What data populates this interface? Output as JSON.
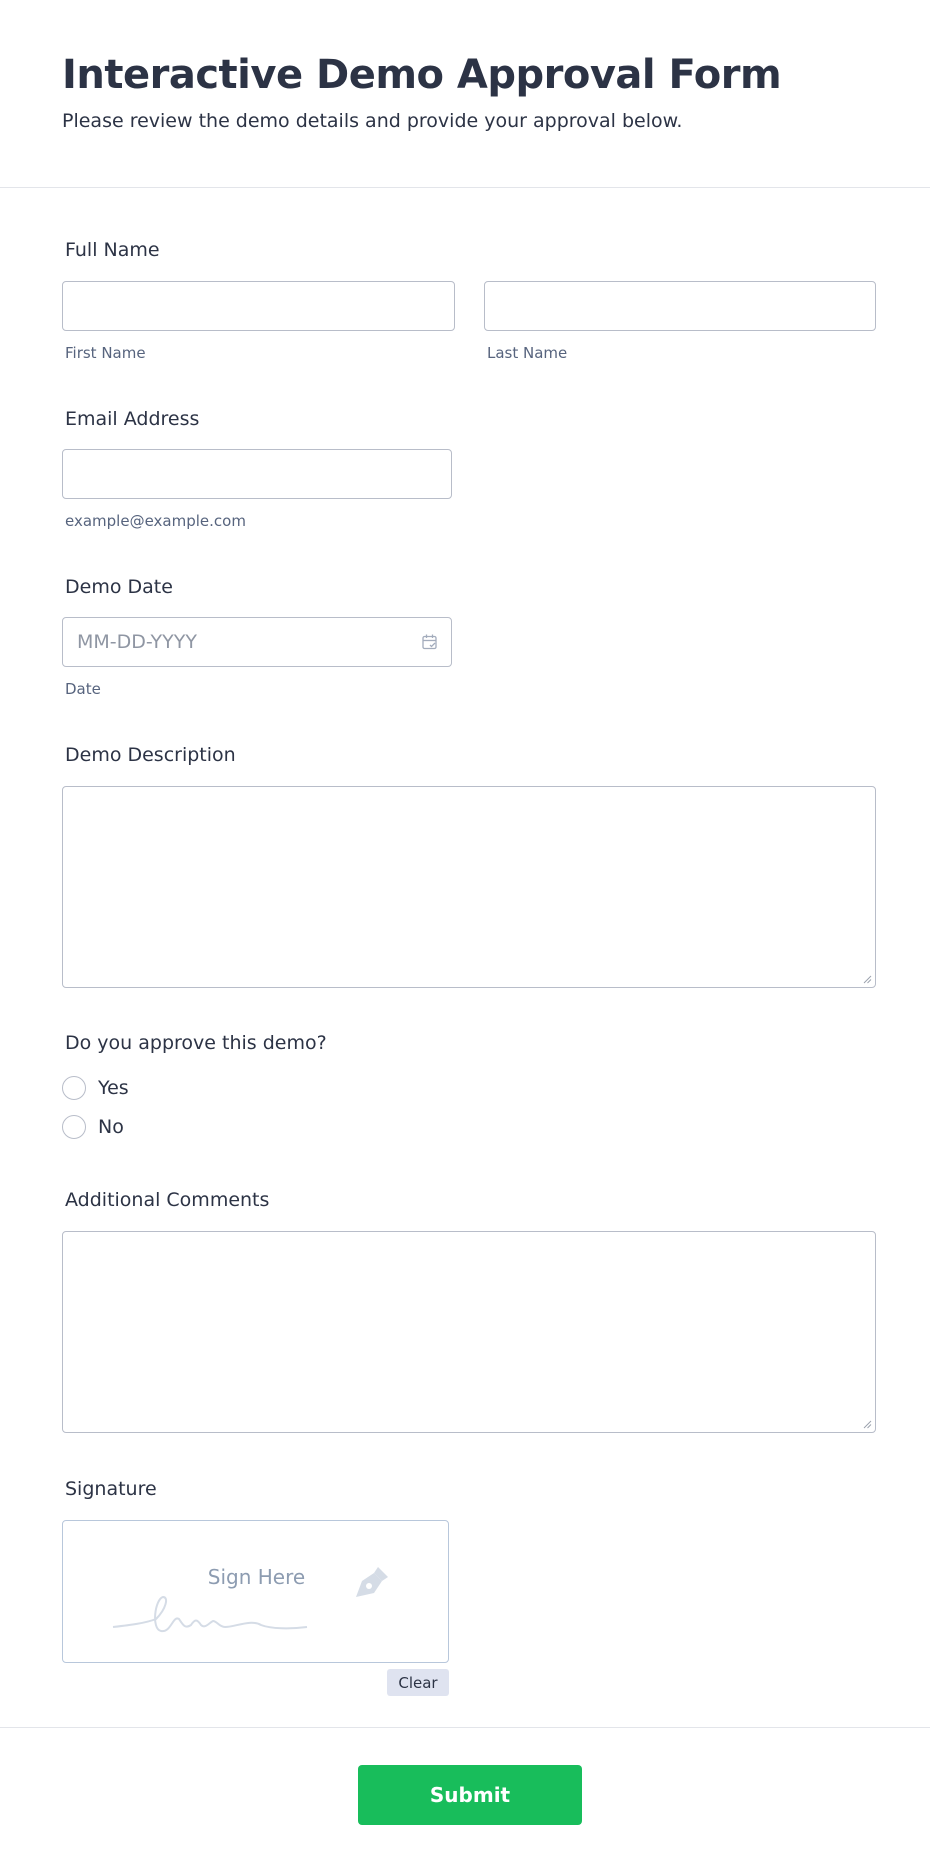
{
  "header": {
    "title": "Interactive Demo Approval Form",
    "subtitle": "Please review the demo details and provide your approval below."
  },
  "full_name": {
    "label": "Full Name",
    "first_sublabel": "First Name",
    "last_sublabel": "Last Name",
    "first_value": "",
    "last_value": ""
  },
  "email": {
    "label": "Email Address",
    "sublabel": "example@example.com",
    "value": ""
  },
  "demo_date": {
    "label": "Demo Date",
    "placeholder": "MM-DD-YYYY",
    "sublabel": "Date",
    "icon": "calendar-icon"
  },
  "demo_description": {
    "label": "Demo Description"
  },
  "approval": {
    "label": "Do you approve this demo?",
    "options": [
      "Yes",
      "No"
    ]
  },
  "comments": {
    "label": "Additional Comments"
  },
  "signature": {
    "label": "Signature",
    "placeholder": "Sign Here",
    "clear_label": "Clear",
    "icon": "pen-nib-icon"
  },
  "submit": {
    "label": "Submit",
    "color": "#18bd5b"
  },
  "colors": {
    "text": "#2c3345",
    "border": "#b8bdc9",
    "accent": "#18bd5b"
  }
}
